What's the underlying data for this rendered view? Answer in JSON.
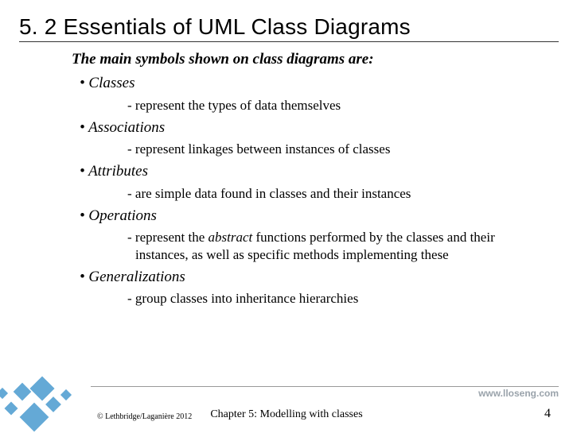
{
  "title": "5. 2 Essentials of UML Class Diagrams",
  "intro": "The main symbols shown on class diagrams are:",
  "items": [
    {
      "label": "Classes",
      "desc": "represent the types of data themselves"
    },
    {
      "label": "Associations",
      "desc": "represent linkages between instances of classes"
    },
    {
      "label": "Attributes",
      "desc": "are simple data found in classes and their instances"
    },
    {
      "label": "Operations",
      "desc_html": "represent the <em>abstract</em> functions performed by the classes and their instances, as well as specific methods implementing these"
    },
    {
      "label": "Generalizations",
      "desc": "group classes into inheritance hierarchies"
    }
  ],
  "footer": {
    "url": "www.lloseng.com",
    "copyright": "© Lethbridge/Laganière 2012",
    "chapter": "Chapter 5: Modelling with classes",
    "page": "4"
  },
  "deco_color": "#4a9bcf"
}
